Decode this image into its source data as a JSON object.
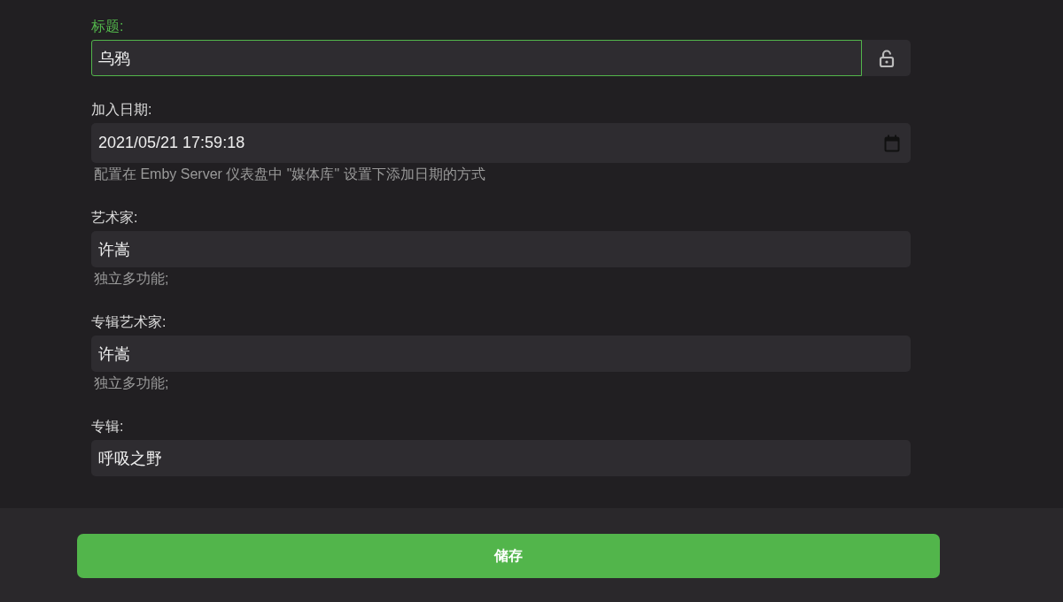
{
  "fields": [
    {
      "kind": "text",
      "label": "标题:",
      "value": "乌鸦",
      "focused": true,
      "lock_button": {
        "locked": false
      }
    },
    {
      "kind": "date",
      "label": "加入日期:",
      "value": "2021/05/21 17:59:18",
      "focused": false,
      "hint": "配置在 Emby Server 仪表盘中 \"媒体库\" 设置下添加日期的方式"
    },
    {
      "kind": "text",
      "label": "艺术家:",
      "value": "许嵩",
      "focused": false,
      "hint": "独立多功能;"
    },
    {
      "kind": "text",
      "label": "专辑艺术家:",
      "value": "许嵩",
      "focused": false,
      "hint": "独立多功能;"
    },
    {
      "kind": "text",
      "label": "专辑:",
      "value": "呼吸之野",
      "focused": false
    }
  ],
  "save_button": {
    "label": "储存"
  }
}
